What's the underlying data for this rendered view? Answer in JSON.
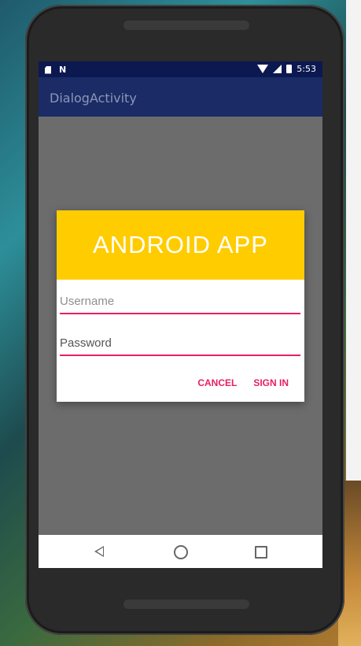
{
  "status_bar": {
    "time": "5:53",
    "left_icons": [
      "sd-card-icon",
      "notification-n-icon"
    ],
    "right_icons": [
      "wifi-icon",
      "signal-icon",
      "battery-icon"
    ]
  },
  "app_bar": {
    "title": "DialogActivity"
  },
  "dialog": {
    "title": "ANDROID APP",
    "username_placeholder": "Username",
    "password_placeholder": "Password",
    "cancel_label": "CANCEL",
    "signin_label": "SIGN IN"
  },
  "nav_bar": {
    "icons": [
      "back-icon",
      "home-icon",
      "recents-icon"
    ]
  },
  "colors": {
    "status_bar": "#0c1850",
    "app_bar": "#1a2b66",
    "dialog_header": "#ffcc00",
    "accent": "#e91e63",
    "screen_bg": "#6c6c6c"
  }
}
